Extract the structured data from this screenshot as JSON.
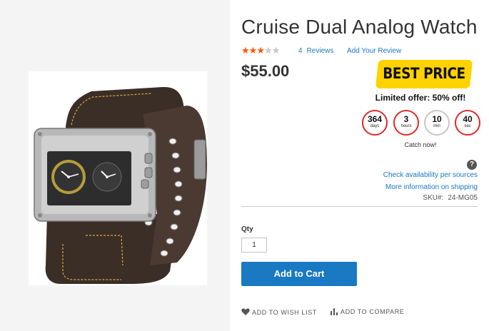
{
  "product": {
    "title": "Cruise Dual Analog Watch",
    "rating": {
      "stars_filled": 3,
      "stars_total": 5,
      "star_color": "#ff5501"
    },
    "reviews": {
      "count": "4",
      "label": "Reviews"
    },
    "add_review_label": "Add Your Review",
    "price": "$55.00",
    "sku_label": "SKU#:",
    "sku_value": "24-MG05"
  },
  "promo": {
    "badge_text": "BEST PRICE",
    "badge_color": "#ffd200",
    "offer_text": "Limited offer: 50% off!",
    "countdown": [
      {
        "value": "364",
        "unit": "days"
      },
      {
        "value": "3",
        "unit": "hours"
      },
      {
        "value": "10",
        "unit": "min"
      },
      {
        "value": "40",
        "unit": "sec"
      }
    ],
    "catch_text": "Catch now!"
  },
  "links": {
    "help_icon": "question-icon",
    "availability": "Check availability per sources",
    "shipping": "More information on shipping"
  },
  "cart": {
    "qty_label": "Qty",
    "qty_value": "1",
    "add_to_cart": "Add to Cart",
    "accent_color": "#1979c3"
  },
  "actions": {
    "wishlist": "ADD TO WISH LIST",
    "compare": "ADD TO COMPARE"
  }
}
